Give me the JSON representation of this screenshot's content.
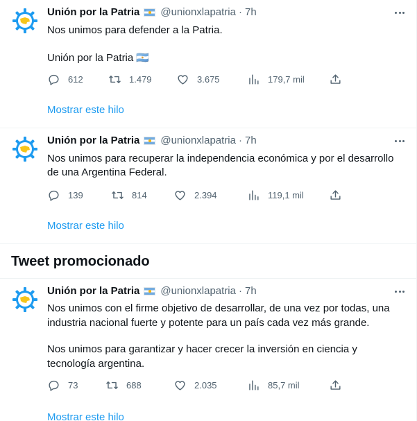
{
  "tweets": [
    {
      "name": "Unión por la Patria",
      "handle": "@unionxlapatria",
      "dot": "·",
      "time": "7h",
      "paragraphs": [
        "Nos unimos para defender a la Patria.",
        "Unión por la Patria 🇦🇷"
      ],
      "replies": "612",
      "retweets": "1.479",
      "likes": "3.675",
      "views": "179,7 mil",
      "thread_link": "Mostrar este hilo"
    },
    {
      "name": "Unión por la Patria",
      "handle": "@unionxlapatria",
      "dot": "·",
      "time": "7h",
      "paragraphs": [
        "Nos unimos para recuperar la independencia económica y por el desarrollo de una Argentina Federal."
      ],
      "replies": "139",
      "retweets": "814",
      "likes": "2.394",
      "views": "119,1 mil",
      "thread_link": "Mostrar este hilo"
    },
    {
      "name": "Unión por la Patria",
      "handle": "@unionxlapatria",
      "dot": "·",
      "time": "7h",
      "paragraphs": [
        "Nos unimos con el firme objetivo de desarrollar, de una vez por todas, una industria nacional fuerte y potente para un país cada vez más grande.",
        "Nos unimos para garantizar y hacer crecer la inversión en ciencia y tecnología argentina."
      ],
      "replies": "73",
      "retweets": "688",
      "likes": "2.035",
      "views": "85,7 mil",
      "thread_link": "Mostrar este hilo"
    }
  ],
  "section": {
    "promoted_title": "Tweet promocionado"
  },
  "icons": {
    "reply": "reply-icon",
    "retweet": "retweet-icon",
    "like": "heart-icon",
    "views": "views-icon",
    "share": "share-icon",
    "more": "more-options-icon",
    "flag": "argentina-flag-icon"
  },
  "colors": {
    "link": "#1d9bf0",
    "text": "#0f1419",
    "secondary": "#536471",
    "avatar_blue": "#1d9bf0",
    "avatar_yellow": "#f7c51b"
  }
}
